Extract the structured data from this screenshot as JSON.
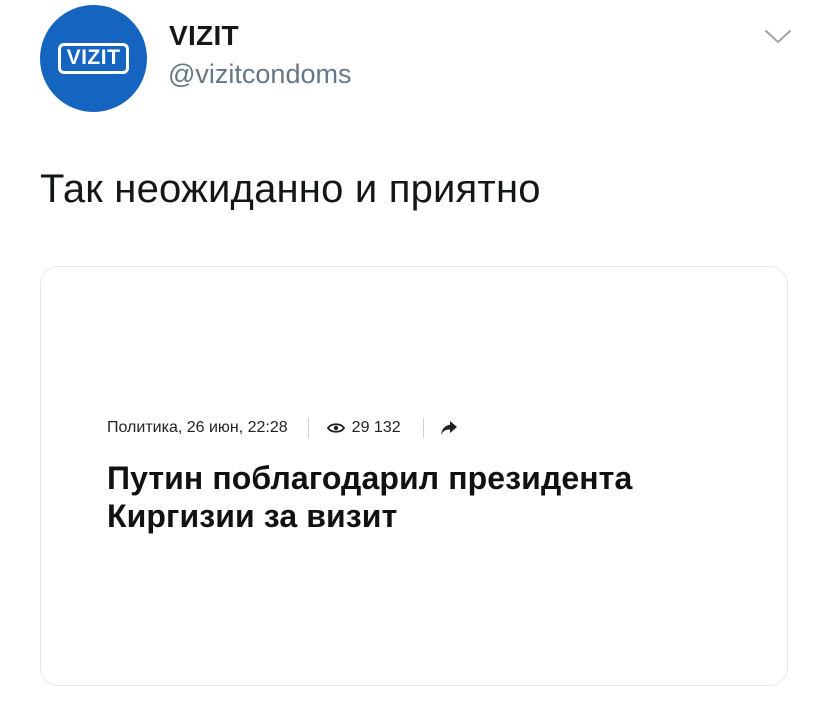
{
  "tweet": {
    "avatar_logo_text": "VIZIT",
    "display_name": "VIZIT",
    "handle": "@vizitcondoms",
    "text": "Так неожиданно и приятно",
    "menu_icon": "chevron-down-icon"
  },
  "article": {
    "meta_category_date": "Политика, 26 июн, 22:28",
    "views_icon": "eye-icon",
    "views": "29 132",
    "share_icon": "share-arrow-icon",
    "headline": "Путин поблагодарил президента Киргизии за визит"
  },
  "colors": {
    "avatar_bg": "#1565c0",
    "handle": "#657786",
    "text": "#14171a"
  }
}
